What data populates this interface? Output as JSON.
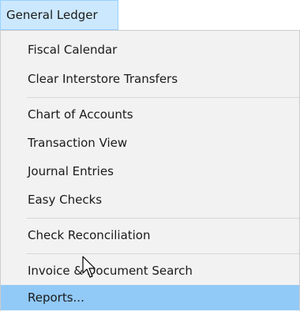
{
  "menubar": {
    "active_menu_label": "General Ledger"
  },
  "menu": {
    "items": [
      {
        "label": "Fiscal Calendar"
      },
      {
        "label": "Clear Interstore Transfers"
      },
      {
        "label": "Chart of Accounts"
      },
      {
        "label": "Transaction View"
      },
      {
        "label": "Journal Entries"
      },
      {
        "label": "Easy Checks"
      },
      {
        "label": "Check Reconciliation"
      },
      {
        "label": "Invoice & Document Search"
      },
      {
        "label": "Reports..."
      }
    ],
    "highlighted_item": "Reports..."
  },
  "colors": {
    "menubar_active_bg": "#cce8ff",
    "menu_bg": "#f2f2f2",
    "highlight_bg": "#91c9f7",
    "separator": "#d7d7d7"
  },
  "icons": {
    "cursor": "arrow-cursor-icon"
  }
}
